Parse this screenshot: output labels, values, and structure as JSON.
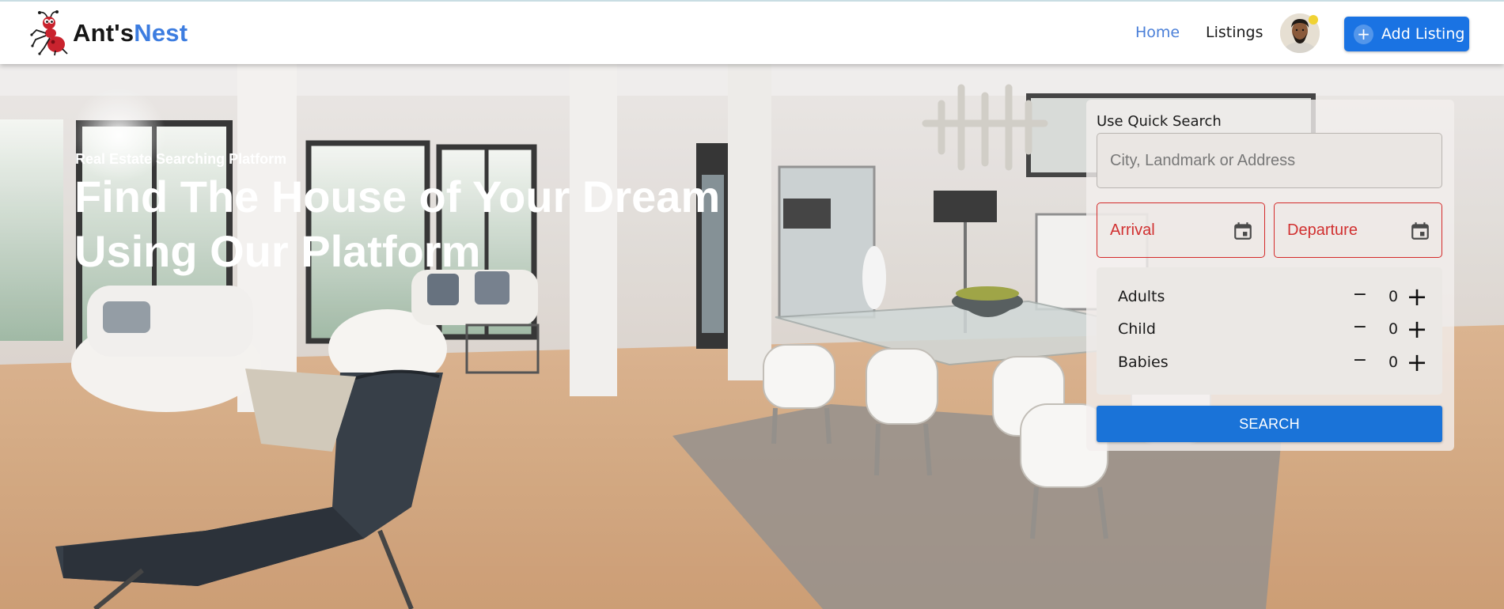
{
  "brand": {
    "name_part1": "Ant's",
    "name_part2": "Nest"
  },
  "nav": {
    "home": "Home",
    "listings": "Listings",
    "add_listing": "Add Listing"
  },
  "hero": {
    "eyebrow": "Real Estate Searching Platform",
    "headline": "Find The House of Your Dream Using Our Platform"
  },
  "quick_search": {
    "title": "Use Quick Search",
    "location_placeholder": "City, Landmark or Address",
    "arrival_label": "Arrival",
    "departure_label": "Departure",
    "guests": [
      {
        "label": "Adults",
        "count": "0"
      },
      {
        "label": "Child",
        "count": "0"
      },
      {
        "label": "Babies",
        "count": "0"
      }
    ],
    "minus_symbol": "−",
    "plus_symbol": "+",
    "search_label": "SEARCH"
  },
  "icons": {
    "logo": "ant-mascot-icon",
    "add": "plus-circle-icon",
    "calendar": "calendar-icon",
    "avatar": "user-avatar"
  },
  "colors": {
    "accent": "#1a73e3",
    "brand_blue": "#3d7de0",
    "nav_active": "#4a7fd8",
    "date_error": "#d42a2a",
    "logo_red": "#c9232e"
  }
}
